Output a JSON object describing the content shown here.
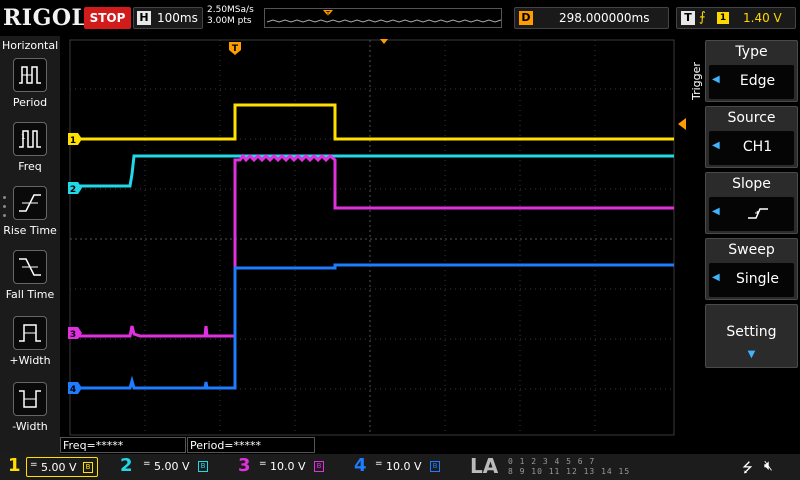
{
  "topbar": {
    "brand": "RIGOL",
    "run_state": "STOP",
    "horizontal_letter": "H",
    "timebase": "100ms",
    "sample_rate": "2.50MSa/s",
    "memory_depth": "3.00M pts",
    "delay_letter": "D",
    "delay": "298.000000ms",
    "trigger_letter": "T",
    "trigger_source_badge": "1",
    "trigger_level": "1.40 V"
  },
  "left_menu": {
    "title": "Horizontal",
    "items": [
      {
        "label": "Period",
        "icon": "period-icon"
      },
      {
        "label": "Freq",
        "icon": "freq-icon"
      },
      {
        "label": "Rise Time",
        "icon": "rise-time-icon"
      },
      {
        "label": "Fall Time",
        "icon": "fall-time-icon"
      },
      {
        "label": "+Width",
        "icon": "positive-width-icon"
      },
      {
        "label": "-Width",
        "icon": "negative-width-icon"
      }
    ]
  },
  "right_menu": {
    "section": "Trigger",
    "type": {
      "label": "Type",
      "value": "Edge"
    },
    "source": {
      "label": "Source",
      "value": "CH1"
    },
    "slope": {
      "label": "Slope",
      "value_icon": "rising-edge-icon"
    },
    "sweep": {
      "label": "Sweep",
      "value": "Single"
    },
    "setting": {
      "label": "Setting"
    }
  },
  "measurements": {
    "freq": "Freq=*****",
    "period": "Period=*****"
  },
  "channels": [
    {
      "num": "1",
      "coupling": "=",
      "scale": "5.00 V",
      "color": "#ffe000"
    },
    {
      "num": "2",
      "coupling": "=",
      "scale": "5.00 V",
      "color": "#22d8e8"
    },
    {
      "num": "3",
      "coupling": "=",
      "scale": "10.0 V",
      "color": "#e030e0"
    },
    {
      "num": "4",
      "coupling": "=",
      "scale": "10.0 V",
      "color": "#1e7cff"
    }
  ],
  "bottombar": {
    "la_label": "LA",
    "la_bits_row1": "0 1 2 3 4 5 6 7",
    "la_bits_row2": "8 9 10 11 12 13 14 15"
  },
  "markers": {
    "trigger_position": "T",
    "ch1": "1",
    "ch2": "2",
    "ch3": "3",
    "ch4": "4"
  },
  "colors": {
    "ch1": "#ffe000",
    "ch2": "#22d8e8",
    "ch3": "#e030e0",
    "ch4": "#1e7cff",
    "stop": "#d21c1c",
    "delay_accent": "#ff9c00",
    "menu_arrow": "#3fb4ff"
  }
}
